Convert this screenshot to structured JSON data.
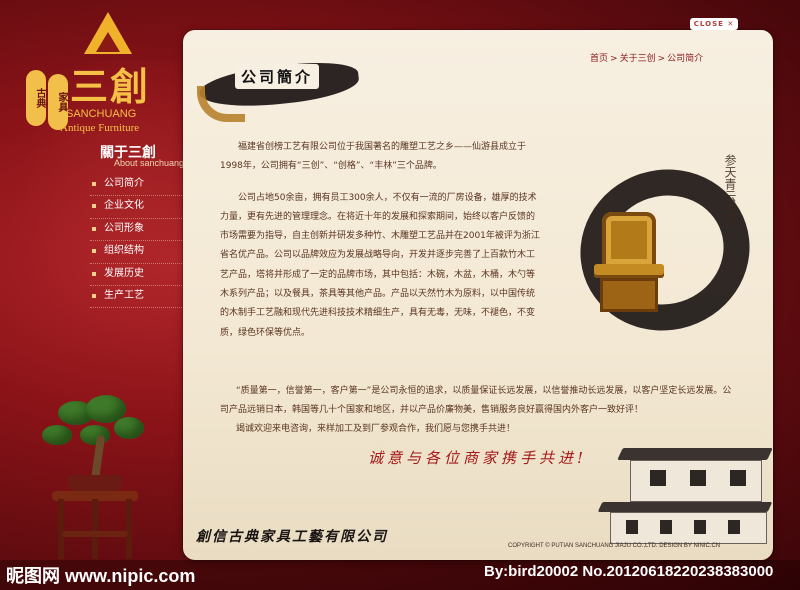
{
  "brand": {
    "name_cn": "三創",
    "seal_text_1": "古典",
    "seal_text_2": "家具",
    "name_en": "SANCHUANG",
    "tagline_en": "Antique Furniture"
  },
  "sidebar": {
    "title": "關于三創",
    "subtitle": "About sanchuang",
    "items": [
      {
        "label": "公司简介"
      },
      {
        "label": "企业文化"
      },
      {
        "label": "公司形象"
      },
      {
        "label": "组织结构"
      },
      {
        "label": "发展历史"
      },
      {
        "label": "生产工艺"
      }
    ]
  },
  "close_button": {
    "label": "CLOSE ✕"
  },
  "page_title": "公司簡介",
  "breadcrumb": [
    "首页",
    "关于三创",
    "公司简介"
  ],
  "breadcrumb_sep": ">",
  "content": {
    "p1": "福建省创榜工艺有限公司位于我国著名的雕塑工艺之乡——仙游县成立于1998年，公司拥有“三创”、“创格”、“丰林”三个品牌。",
    "p2": "公司占地50余亩，拥有员工300余人，不仅有一流的厂房设备，雄厚的技术力量，更有先进的管理理念。在将近十年的发展和探索期间，始终以客户反馈的市场需要为指导，自主创新并研发多种竹、木雕塑工艺品并在2001年被评为浙江省名优产品。公司以品牌效应为发展战略导向，开发并逐步完善了上百款竹木工艺产品，塔将并形成了一定的品牌市场，其中包括：木碗，木盆，木桶，木勺等木系列产品；以及餐具，茶具等其他产品。产品以天然竹木为原料，以中国传统的木制手工艺融和现代先进科技技术精细生产，具有无毒，无味，不褪色，不变质，绿色环保等优点。",
    "p3": "“质量第一，信誉第一，客户第一”是公司永恒的追求，以质量保证长远发展，以信誉推动长远发展，以客户坚定长远发展。公司产品远销日本，韩国等几十个国家和地区，并以产品价廉物美，售销服务良好赢得国内外客户一致好评！",
    "p4": "竭诚欢迎来电咨询，来样加工及到厂参观合作，我们愿与您携手共进！"
  },
  "calligraphy_text": "参天青云书画",
  "slogan": "诚意与各位商家携手共进!",
  "company_signature": "創信古典家具工藝有限公司",
  "copyright": "COPYRIGHT © PUTIAN SANCHUANG JIAJU CO.,LTD. DESIGN BY NINIC.CN",
  "watermark": {
    "left": "昵图网 www.nipic.com",
    "right": "By:bird20002  No.20120618220238383000"
  }
}
